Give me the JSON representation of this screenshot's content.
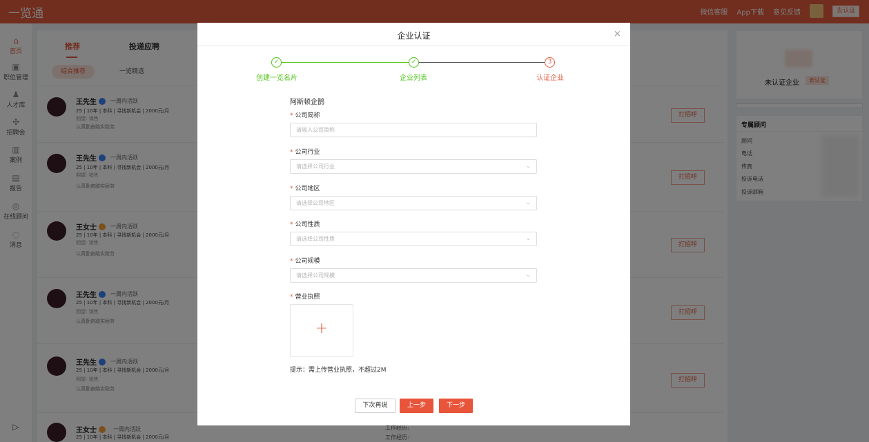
{
  "topbar": {
    "brand": "一览通",
    "nav": [
      "微信客服",
      "App下载",
      "意见反馈"
    ],
    "cert_button": "去认证"
  },
  "sidebar": {
    "items": [
      {
        "label": "首页",
        "icon": "home-icon",
        "glyph": "⌂",
        "active": true
      },
      {
        "label": "职位管理",
        "icon": "briefcase-icon",
        "glyph": "▣",
        "active": false
      },
      {
        "label": "人才库",
        "icon": "person-icon",
        "glyph": "♟",
        "active": false
      },
      {
        "label": "招聘会",
        "icon": "network-icon",
        "glyph": "✣",
        "active": false
      },
      {
        "label": "案例",
        "icon": "book-icon",
        "glyph": "▥",
        "active": false
      },
      {
        "label": "报告",
        "icon": "report-icon",
        "glyph": "▤",
        "active": false
      },
      {
        "label": "在线顾问",
        "icon": "consultant-icon",
        "glyph": "◎",
        "active": false
      },
      {
        "label": "消息",
        "icon": "message-icon",
        "glyph": "◌",
        "active": false
      }
    ],
    "expand_glyph": "▷"
  },
  "main": {
    "tabs": [
      "推荐",
      "投递应聘"
    ],
    "filters": [
      "综合推荐",
      "一览精选"
    ],
    "card_button": "打招呼",
    "cards": [
      {
        "name": "王先生",
        "badge": "#3b82f6",
        "active": "一周内活跃",
        "meta": "25 | 10年 | 本科 | 寻找新机会 | 2000元/月",
        "exp_label": "期望:",
        "exp_value": "销售",
        "desc": "认真勤奋踏实耐劳"
      },
      {
        "name": "王先生",
        "badge": "#3b82f6",
        "active": "一周内活跃",
        "meta": "25 | 10年 | 本科 | 寻找新机会 | 2000元/月",
        "exp_label": "期望:",
        "exp_value": "销售",
        "desc": "认真勤奋踏实耐劳"
      },
      {
        "name": "王女士",
        "badge": "#f5a33b",
        "active": "一周内活跃",
        "meta": "25 | 10年 | 本科 | 寻找新机会 | 2000元/月",
        "exp_label": "期望:",
        "exp_value": "销售",
        "desc": "认真勤奋踏实耐劳"
      },
      {
        "name": "王先生",
        "badge": "#3b82f6",
        "active": "一周内活跃",
        "meta": "25 | 10年 | 本科 | 寻找新机会 | 2000元/月",
        "exp_label": "期望:",
        "exp_value": "销售",
        "desc": "认真勤奋踏实耐劳"
      },
      {
        "name": "王先生",
        "badge": "#3b82f6",
        "active": "一周内活跃",
        "meta": "25 | 10年 | 本科 | 寻找新机会 | 2000元/月",
        "exp_label": "期望:",
        "exp_value": "销售",
        "desc": "认真勤奋踏实耐劳"
      },
      {
        "name": "王女士",
        "badge": "#f5a33b",
        "active": "一周内活跃",
        "meta": "25 | 10年 | 本科 | 寻找新机会 | 2000元/月",
        "exp_label": "",
        "exp_value": "",
        "desc": ""
      }
    ],
    "bottom_hint": "工作经历:"
  },
  "right_panel": {
    "uncertified": "未认证企业",
    "cert_button": "去认证",
    "advisor_title": "专属顾问",
    "advisor_items": [
      "顾问",
      "电话",
      "传真",
      "投诉电话",
      "投诉邮箱"
    ]
  },
  "modal": {
    "title": "企业认证",
    "close_glyph": "×",
    "steps": [
      {
        "label": "创建一览名片",
        "mark": "✓"
      },
      {
        "label": "企业列表",
        "mark": "✓"
      },
      {
        "label": "认证企业",
        "mark": "3"
      }
    ],
    "company_name": "阿斯顿企鹊",
    "fields": [
      {
        "label": "公司简称",
        "placeholder": "请输入公司简称",
        "type": "input"
      },
      {
        "label": "公司行业",
        "placeholder": "请选择公司行业",
        "type": "select"
      },
      {
        "label": "公司地区",
        "placeholder": "请选择公司地区",
        "type": "select"
      },
      {
        "label": "公司性质",
        "placeholder": "请选择公司性质",
        "type": "select"
      },
      {
        "label": "公司规模",
        "placeholder": "请选择公司规模",
        "type": "select"
      }
    ],
    "license_label": "营业执照",
    "upload_glyph": "+",
    "tip": "提示：需上传营业执照，不超过2M",
    "buttons": {
      "later": "下次再说",
      "prev": "上一步",
      "next": "下一步"
    },
    "colors": {
      "accent": "#e25a3d",
      "done": "#52c41a"
    }
  }
}
